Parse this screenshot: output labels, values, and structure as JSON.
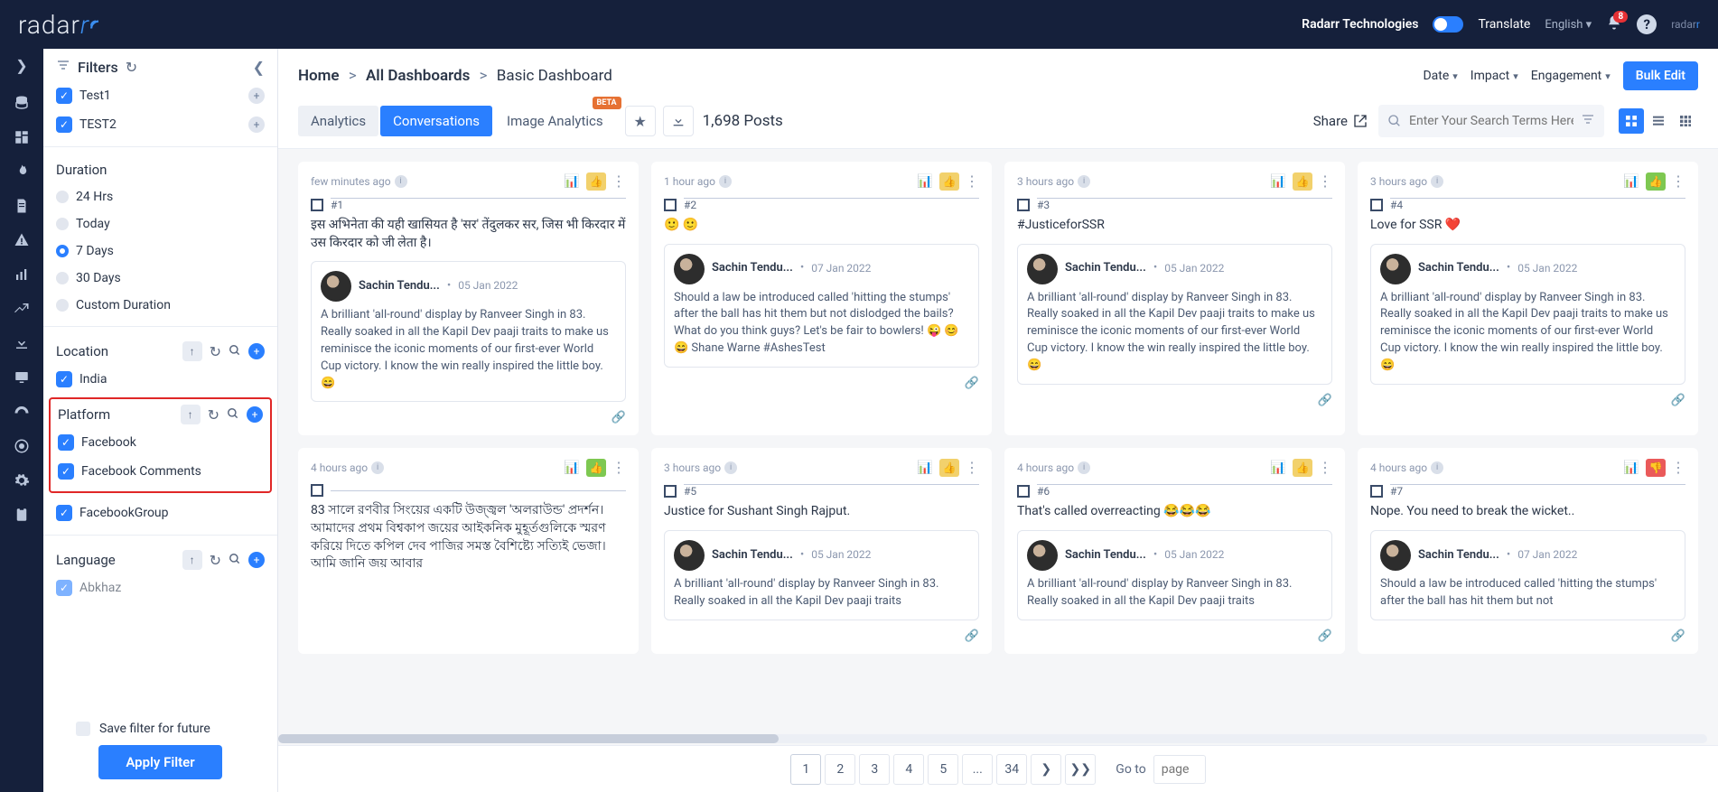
{
  "brand": {
    "name": "radar",
    "tail": "r"
  },
  "topbar": {
    "company": "Radarr Technologies",
    "translate": "Translate",
    "language": "English",
    "notif_count": "8"
  },
  "sidebar": {
    "title": "Filters",
    "dashboards": [
      {
        "label": "Test1"
      },
      {
        "label": "TEST2"
      }
    ],
    "duration": {
      "title": "Duration",
      "options": [
        "24 Hrs",
        "Today",
        "7 Days",
        "30 Days",
        "Custom Duration"
      ],
      "selected": "7 Days"
    },
    "location": {
      "title": "Location",
      "items": [
        "India"
      ]
    },
    "platform": {
      "title": "Platform",
      "items": [
        "Facebook",
        "Facebook Comments",
        "FacebookGroup"
      ]
    },
    "language": {
      "title": "Language",
      "items": [
        "Abkhaz"
      ]
    },
    "save_label": "Save filter for future",
    "apply_label": "Apply Filter"
  },
  "breadcrumbs": [
    "Home",
    "All Dashboards",
    "Basic Dashboard"
  ],
  "crumb_dropdowns": [
    "Date",
    "Impact",
    "Engagement"
  ],
  "bulk_edit": "Bulk Edit",
  "tabs": {
    "analytics": "Analytics",
    "conversations": "Conversations",
    "image_analytics": "Image Analytics",
    "image_badge": "BETA"
  },
  "posts_count": "1,698 Posts",
  "share": "Share",
  "search_placeholder": "Enter Your Search Terms Here",
  "cards": [
    {
      "time": "few minutes ago",
      "rank": "#1",
      "text": "इस अभिनेता की यही खासियत है 'सर' तेंदुलकर सर, जिस भी किरदार में उस किरदार को जी लेता है।",
      "author": "Sachin Tendu...",
      "date": "05 Jan 2022",
      "quote": "A brilliant 'all-round' display by Ranveer Singh in 83. Really soaked in all the Kapil Dev paaji traits to make us reminisce the iconic moments of our first-ever World Cup victory. I know the win really inspired the little boy. 😄",
      "thumb": "neutral"
    },
    {
      "time": "1 hour ago",
      "rank": "#2",
      "text": "🙂 🙂",
      "author": "Sachin Tendu...",
      "date": "07 Jan 2022",
      "quote": "Should a law be introduced called 'hitting the stumps' after the ball has hit them but not dislodged the bails? What do you think guys? Let's be fair to bowlers! 😜 😊 😄 Shane Warne #AshesTest",
      "thumb": "neutral"
    },
    {
      "time": "3 hours ago",
      "rank": "#3",
      "text": "#JusticeforSSR",
      "author": "Sachin Tendu...",
      "date": "05 Jan 2022",
      "quote": "A brilliant 'all-round' display by Ranveer Singh in 83. Really soaked in all the Kapil Dev paaji traits to make us reminisce the iconic moments of our first-ever World Cup victory. I know the win really inspired the little boy. 😄",
      "thumb": "neutral"
    },
    {
      "time": "3 hours ago",
      "rank": "#4",
      "text": "Love for SSR ❤️",
      "author": "Sachin Tendu...",
      "date": "05 Jan 2022",
      "quote": "A brilliant 'all-round' display by Ranveer Singh in 83. Really soaked in all the Kapil Dev paaji traits to make us reminisce the iconic moments of our first-ever World Cup victory. I know the win really inspired the little boy. 😄",
      "thumb": "up"
    },
    {
      "time": "4 hours ago",
      "rank": "",
      "text": "83 সালে রণবীর সিংয়ের একটি উজ্জ্বল 'অলরাউন্ড' প্রদর্শন। আমাদের প্রথম বিশ্বকাপ জয়ের আইকনিক মুহূর্তগুলিকে স্মরণ করিয়ে দিতে কপিল দেব পাজির সমস্ত বৈশিষ্ট্যে সত্যিই ভেজা। আমি জানি জয় আবার",
      "author": "",
      "date": "",
      "quote": "",
      "thumb": "up"
    },
    {
      "time": "3 hours ago",
      "rank": "#5",
      "text": "Justice for Sushant Singh Rajput.",
      "author": "Sachin Tendu...",
      "date": "05 Jan 2022",
      "quote": "A brilliant 'all-round' display by Ranveer Singh in 83. Really soaked in all the Kapil Dev paaji traits",
      "thumb": "neutral"
    },
    {
      "time": "4 hours ago",
      "rank": "#6",
      "text": "That's called overreacting 😂😂😂",
      "author": "Sachin Tendu...",
      "date": "05 Jan 2022",
      "quote": "A brilliant 'all-round' display by Ranveer Singh in 83. Really soaked in all the Kapil Dev paaji traits",
      "thumb": "neutral"
    },
    {
      "time": "4 hours ago",
      "rank": "#7",
      "text": "Nope. You need to break the wicket..",
      "author": "Sachin Tendu...",
      "date": "07 Jan 2022",
      "quote": "Should a law be introduced called 'hitting the stumps' after the ball has hit them but not",
      "thumb": "down"
    }
  ],
  "pagination": {
    "pages": [
      "1",
      "2",
      "3",
      "4",
      "5",
      "...",
      "34"
    ],
    "active": "1",
    "goto": "Go to",
    "goto_placeholder": "page"
  }
}
